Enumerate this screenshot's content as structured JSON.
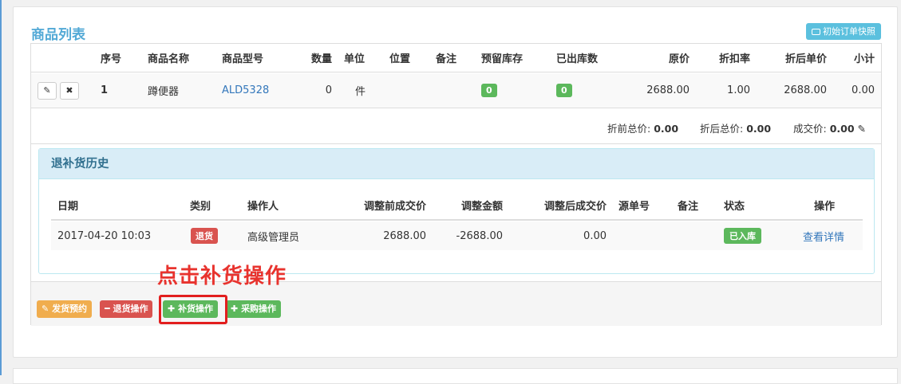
{
  "goods": {
    "title": "商品列表",
    "snapshot_label": "初始订单快照",
    "headers": [
      "序号",
      "商品名称",
      "商品型号",
      "数量",
      "单位",
      "位置",
      "备注",
      "预留库存",
      "已出库数",
      "原价",
      "折扣率",
      "折后单价",
      "小计"
    ],
    "row": {
      "seq": "1",
      "name": "蹲便器",
      "model": "ALD5328",
      "qty": "0",
      "unit": "件",
      "position": "",
      "note": "",
      "reserved": "0",
      "shipped": "0",
      "price": "2688.00",
      "discount": "1.00",
      "disc_price": "2688.00",
      "subtotal": "0.00"
    },
    "totals": {
      "before_label": "折前总价:",
      "before": "0.00",
      "after_label": "折后总价:",
      "after": "0.00",
      "deal_label": "成交价:",
      "deal": "0.00"
    }
  },
  "history": {
    "title": "退补货历史",
    "headers": [
      "日期",
      "类别",
      "操作人",
      "调整前成交价",
      "调整金额",
      "调整后成交价",
      "源单号",
      "备注",
      "状态",
      "操作"
    ],
    "row": {
      "date": "2017-04-20 10:03",
      "type": "退货",
      "operator": "高级管理员",
      "before": "2688.00",
      "amount": "-2688.00",
      "after": "0.00",
      "source": "",
      "note": "",
      "status": "已入库",
      "action": "查看详情"
    }
  },
  "annotation": "点击补货操作",
  "actions": {
    "ship": "发货预约",
    "return": "退货操作",
    "restock": "补货操作",
    "purchase": "采购操作"
  },
  "colors": {
    "title": "#52a9d6",
    "info": "#5bc0de",
    "success": "#5cb85c",
    "danger": "#d9534f",
    "warning": "#f0ad4e",
    "annotation": "#e8332e"
  }
}
